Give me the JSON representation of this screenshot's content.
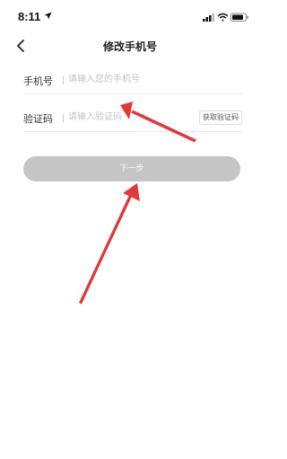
{
  "status_bar": {
    "time": "8:11",
    "icons": [
      "location-arrow-icon",
      "cellular-signal-icon",
      "wifi-icon",
      "battery-icon"
    ]
  },
  "nav": {
    "back_icon": "chevron-left-icon",
    "title": "修改手机号"
  },
  "form": {
    "phone": {
      "label": "手机号",
      "placeholder": "请输入您的手机号",
      "value": ""
    },
    "code": {
      "label": "验证码",
      "placeholder": "请输入验证码",
      "value": "",
      "get_code_label": "获取验证码"
    }
  },
  "next_button": {
    "label": "下一步",
    "enabled": false
  },
  "annotation": {
    "arrow_color": "#e0393b"
  },
  "colors": {
    "button_disabled": "#c5c5c5",
    "placeholder": "#c3c3c3"
  }
}
